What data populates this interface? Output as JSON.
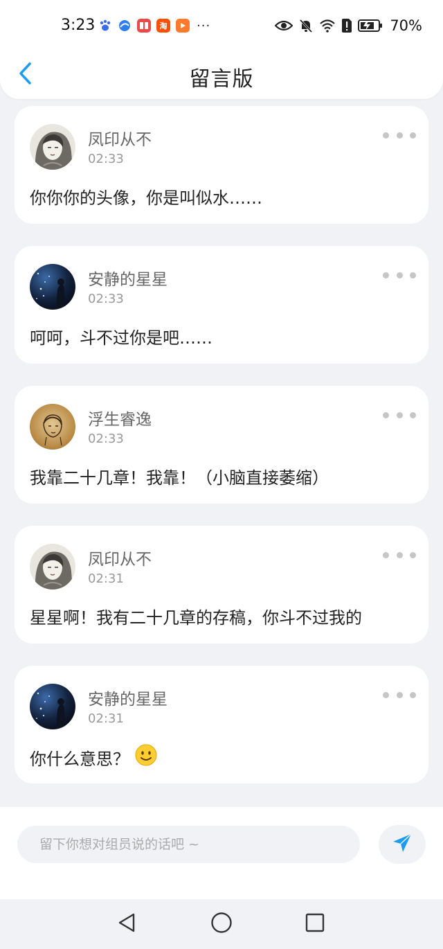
{
  "status_bar": {
    "time": "3:23",
    "more_indicator": "···",
    "battery_percent": "70%",
    "app_icons": [
      {
        "name": "baidu-paw-icon",
        "color": "#3a6ee8"
      },
      {
        "name": "blue-ball-app-icon",
        "color": "#2f80ed"
      },
      {
        "name": "red-book-app-icon",
        "color": "#ea4a4a"
      },
      {
        "name": "taobao-app-icon",
        "color": "#ff5000",
        "glyph": "淘"
      },
      {
        "name": "orange-play-app-icon",
        "color": "#ff7a2d"
      }
    ]
  },
  "header": {
    "title": "留言版"
  },
  "messages": [
    {
      "author": "凤印从不",
      "time": "02:33",
      "text": "你你你的头像，你是叫似水……",
      "avatar": "sketch-portrait"
    },
    {
      "author": "安静的星星",
      "time": "02:33",
      "text": "呵呵，斗不过你是吧……",
      "avatar": "night-sky"
    },
    {
      "author": "浮生睿逸",
      "time": "02:33",
      "text": "我靠二十几章！我靠！（小脑直接萎缩）",
      "avatar": "sepia-sketch"
    },
    {
      "author": "凤印从不",
      "time": "02:31",
      "text": "星星啊！我有二十几章的存稿，你斗不过我的",
      "avatar": "sketch-portrait"
    },
    {
      "author": "安静的星星",
      "time": "02:31",
      "text": "你什么意思？",
      "avatar": "night-sky",
      "emoji": "slightly-smiling-face"
    }
  ],
  "input": {
    "placeholder": "留下你想对组员说的话吧 ~"
  },
  "colors": {
    "accent": "#1d9bf0",
    "background": "#f1f2f6",
    "card": "#ffffff"
  }
}
